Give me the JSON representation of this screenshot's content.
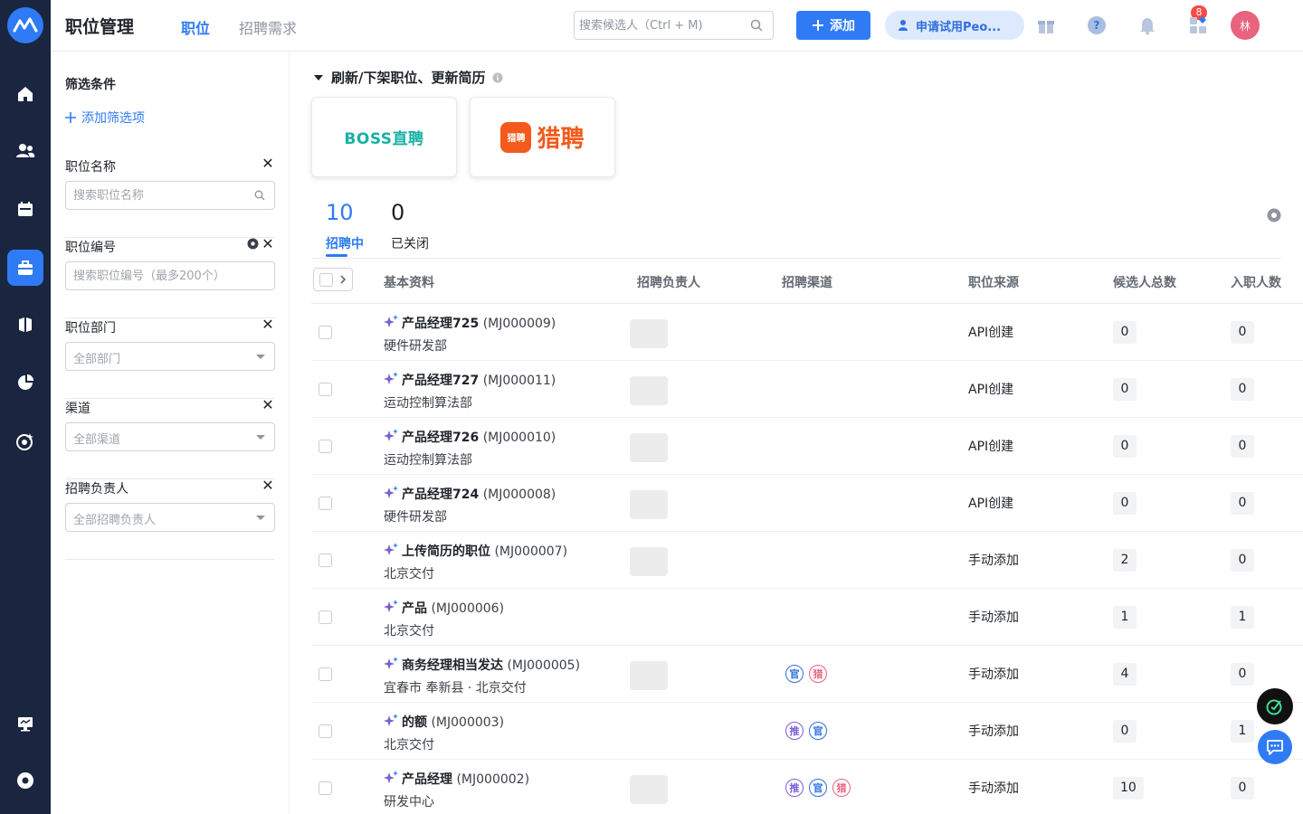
{
  "header": {
    "app_title": "职位管理",
    "tabs": [
      {
        "label": "职位",
        "active": true
      },
      {
        "label": "招聘需求",
        "active": false
      }
    ],
    "search_placeholder": "搜索候选人（Ctrl + M)",
    "add_label": "添加",
    "trial_label": "申请试用Peo...",
    "notification_count": "8",
    "avatar_text": "林"
  },
  "sidebar": {
    "items": [
      "home-icon",
      "people-icon",
      "calendar-icon",
      "briefcase-icon",
      "book-icon",
      "pie-chart-icon",
      "target-icon"
    ],
    "active_index": 3,
    "bottom_items": [
      "monitor-icon",
      "settings-icon"
    ]
  },
  "filters": {
    "title": "筛选条件",
    "add_label": "添加筛选项",
    "sections": [
      {
        "label": "职位名称",
        "placeholder": "搜索职位名称",
        "type": "search"
      },
      {
        "label": "职位编号",
        "placeholder": "搜索职位编号（最多200个）",
        "type": "text"
      },
      {
        "label": "职位部门",
        "placeholder": "全部部门",
        "type": "select"
      },
      {
        "label": "渠道",
        "placeholder": "全部渠道",
        "type": "select"
      },
      {
        "label": "招聘负责人",
        "placeholder": "全部招聘负责人",
        "type": "select"
      }
    ]
  },
  "main": {
    "section_title": "刷新/下架职位、更新简历",
    "channels": {
      "boss": "BOSS",
      "boss_suffix": "直聘",
      "liepin_logo": "猎聘",
      "liepin": "猎聘"
    },
    "stats": [
      {
        "value": "10",
        "label": "招聘中",
        "active": true
      },
      {
        "value": "0",
        "label": "已关闭",
        "active": false
      }
    ],
    "columns": [
      "基本资料",
      "招聘负责人",
      "招聘渠道",
      "职位来源",
      "候选人总数",
      "入职人数"
    ],
    "rows": [
      {
        "name": "产品经理725",
        "code": "(MJ000009)",
        "dept": "硬件研发部",
        "owner": true,
        "channels": [],
        "source": "API创建",
        "total": "0",
        "hired": "0"
      },
      {
        "name": "产品经理727",
        "code": "(MJ000011)",
        "dept": "运动控制算法部",
        "owner": true,
        "channels": [],
        "source": "API创建",
        "total": "0",
        "hired": "0"
      },
      {
        "name": "产品经理726",
        "code": "(MJ000010)",
        "dept": "运动控制算法部",
        "owner": true,
        "channels": [],
        "source": "API创建",
        "total": "0",
        "hired": "0"
      },
      {
        "name": "产品经理724",
        "code": "(MJ000008)",
        "dept": "硬件研发部",
        "owner": true,
        "channels": [],
        "source": "API创建",
        "total": "0",
        "hired": "0"
      },
      {
        "name": "上传简历的职位",
        "code": "(MJ000007)",
        "dept": "北京交付",
        "owner": true,
        "channels": [],
        "source": "手动添加",
        "total": "2",
        "hired": "0"
      },
      {
        "name": "产品",
        "code": "(MJ000006)",
        "dept": "北京交付",
        "owner": false,
        "channels": [],
        "source": "手动添加",
        "total": "1",
        "hired": "1"
      },
      {
        "name": "商务经理相当发达",
        "code": "(MJ000005)",
        "dept": "宜春市 奉新县 · 北京交付",
        "owner": true,
        "channels": [
          {
            "t": "官",
            "c": "g"
          },
          {
            "t": "猎",
            "c": "l"
          }
        ],
        "source": "手动添加",
        "total": "4",
        "hired": "0"
      },
      {
        "name": "的额",
        "code": "(MJ000003)",
        "dept": "北京交付",
        "owner": false,
        "channels": [
          {
            "t": "推",
            "c": "t"
          },
          {
            "t": "官",
            "c": "g"
          }
        ],
        "source": "手动添加",
        "total": "0",
        "hired": "1"
      },
      {
        "name": "产品经理",
        "code": "(MJ000002)",
        "dept": "研发中心",
        "owner": true,
        "channels": [
          {
            "t": "推",
            "c": "t"
          },
          {
            "t": "官",
            "c": "g"
          },
          {
            "t": "猎",
            "c": "l"
          }
        ],
        "source": "手动添加",
        "total": "10",
        "hired": "0"
      }
    ]
  },
  "colors": {
    "accent": "#2f7bf5",
    "rail": "#1a2540",
    "badge": "#f54a45",
    "avatar": "#e8637d"
  }
}
